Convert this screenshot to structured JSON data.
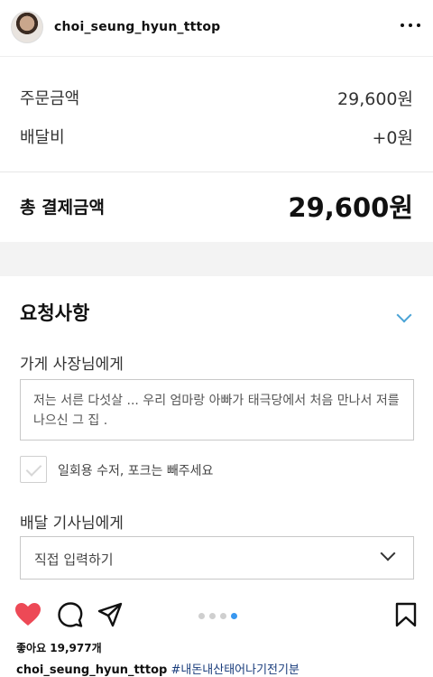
{
  "post": {
    "username": "choi_seung_hyun_tttop",
    "likes": "좋아요 19,977개",
    "caption_tag": "#내돈내산태어나기전기분"
  },
  "receipt": {
    "order_label": "주문금액",
    "order_value": "29,600원",
    "delivery_label": "배달비",
    "delivery_value": "+0원",
    "total_label": "총 결제금액",
    "total_value": "29,600원"
  },
  "request": {
    "title": "요청사항",
    "owner_label": "가게 사장님에게",
    "owner_message": "저는 서른 다섯살 ... 우리 엄마랑 아빠가 태극당에서 처음 만나서 저를 나으신 그 집 .",
    "utensils_label": "일회용 수저, 포크는 빼주세요",
    "utensils_checked": false,
    "driver_label": "배달 기사님에게",
    "driver_select_value": "직접 입력하기"
  },
  "carousel": {
    "count": 4,
    "active_index": 3
  },
  "colors": {
    "heart": "#ed4956",
    "accent": "#3897f0",
    "chevron": "#4aa3d6"
  },
  "icons": [
    "more-icon",
    "heart-icon",
    "comment-icon",
    "share-icon",
    "bookmark-icon",
    "chevron-down-icon"
  ]
}
